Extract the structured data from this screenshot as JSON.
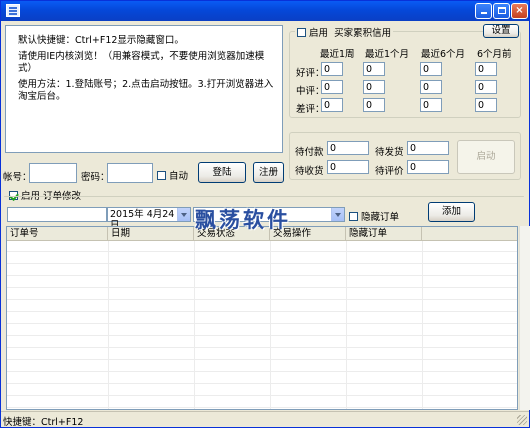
{
  "title_bar": {
    "title": ""
  },
  "info": {
    "lines": [
      "默认快捷键：Ctrl+F12显示隐藏窗口。",
      "请使用IE内核浏览！（用兼容模式，不要使用浏览器加速模式）",
      "使用方法：1.登陆账号；2.点击启动按钮。3.打开浏览器进入淘宝后台。"
    ]
  },
  "credit": {
    "enable_label": "启用",
    "group_label": "买家累积信用",
    "settings_button": "设置",
    "columns": [
      "最近1周",
      "最近1个月",
      "最近6个月",
      "6个月前"
    ],
    "rows": [
      {
        "label": "好评：",
        "values": [
          "0",
          "0",
          "0",
          "0"
        ]
      },
      {
        "label": "中评：",
        "values": [
          "0",
          "0",
          "0",
          "0"
        ]
      },
      {
        "label": "差评：",
        "values": [
          "0",
          "0",
          "0",
          "0"
        ]
      }
    ]
  },
  "orders_status": {
    "pending_payment_label": "待付款",
    "pending_payment_value": "0",
    "pending_ship_label": "待发货",
    "pending_ship_value": "0",
    "pending_receive_label": "待收货",
    "pending_receive_value": "0",
    "pending_review_label": "待评价",
    "pending_review_value": "0",
    "start_button": "启动"
  },
  "login": {
    "account_label": "帐号：",
    "account_value": "",
    "password_label": "密码：",
    "password_value": "",
    "auto_label": "自动",
    "login_button": "登陆",
    "register_button": "注册"
  },
  "order_edit": {
    "enable_label": "启用 订单修改",
    "order_input": "",
    "date_value": "2015年 4月24日,",
    "status_value": "",
    "hide_label": "隐藏订单",
    "add_button": "添加"
  },
  "grid": {
    "columns": [
      "订单号",
      "日期",
      "交易状态",
      "交易操作",
      "隐藏订单"
    ]
  },
  "watermark": "飘荡软件",
  "status_bar": {
    "text": "快捷键：Ctrl+F12"
  }
}
